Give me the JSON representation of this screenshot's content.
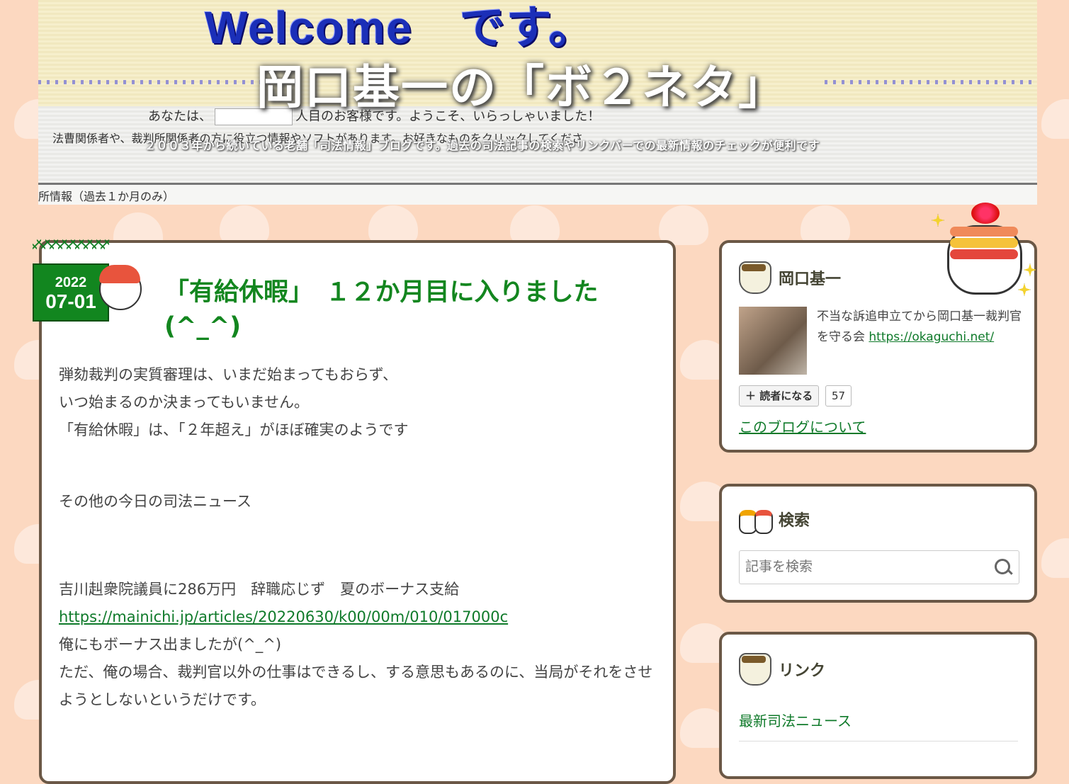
{
  "header": {
    "welcome": "Welcome　です。",
    "title": "岡口基一の「ボ２ネタ」",
    "greeting_before": "あなたは、",
    "greeting_after": "人目のお客様です。ようこそ、いらっしゃいました！",
    "notice": "法曹関係者や、裁判所関係者の方に役立つ情報やソフトがあります。お好きなものをクリックしてくださ",
    "description": "２００３年から続いている老舗「司法情報」ブログです。過去の司法記事の検索やリンクバーでの最新情報のチェックが便利です",
    "recent": "所情報（過去１か月のみ）"
  },
  "article": {
    "date_year": "2022",
    "date_md": "07-01",
    "title": "「有給休暇」　１２か月目に入りました(^_^)",
    "line1": "弾劾裁判の実質審理は、いまだ始まってもおらず、",
    "line2": "いつ始まるのか決まってもいません。",
    "line3": "「有給休暇」は、「２年超え」がほぼ確実のようです",
    "line4": "その他の今日の司法ニュース",
    "line5": "吉川赳衆院議員に286万円　辞職応じず　夏のボーナス支給",
    "link": "https://mainichi.jp/articles/20220630/k00/00m/010/017000c",
    "line6": "俺にもボーナス出ましたが(^_^)",
    "line7": "ただ、俺の場合、裁判官以外の仕事はできるし、する意思もあるのに、当局がそれをさせようとしないというだけです。"
  },
  "sidebar": {
    "profile": {
      "name": "岡口基一",
      "description": "不当な訴追申立てから岡口基一裁判官を守る会",
      "url": "https://okaguchi.net/",
      "reader_button": "読者になる",
      "reader_count": "57",
      "about_link": "このブログについて"
    },
    "search": {
      "title": "検索",
      "placeholder": "記事を検索"
    },
    "links": {
      "title": "リンク",
      "item1": "最新司法ニュース"
    }
  }
}
